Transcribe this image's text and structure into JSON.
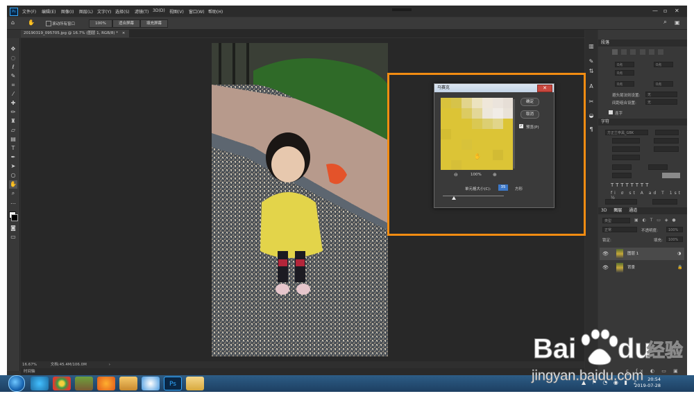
{
  "menubar": {
    "logo": "Ps",
    "items": [
      "文件(F)",
      "编辑(E)",
      "图像(I)",
      "图层(L)",
      "文字(Y)",
      "选择(S)",
      "滤镜(T)",
      "3D(D)",
      "视图(V)",
      "窗口(W)",
      "帮助(H)"
    ],
    "window_controls": [
      "—",
      "▫",
      "✕"
    ]
  },
  "options_bar": {
    "scroll_all_label": "滚动所有窗口",
    "zoom_button": "100%",
    "fit_button": "适合屏幕",
    "fill_button": "填充屏幕"
  },
  "document_tab": {
    "title": "20190319_095705.jpg @ 16.7% (图层 1, RGB/8) *",
    "close": "×"
  },
  "status_bar": {
    "zoom": "16.67%",
    "doc": "文档:45.4M/106.0M"
  },
  "timeline_label": "时间轴",
  "dialog": {
    "title": "马赛克",
    "ok_label": "确定",
    "cancel_label": "取消",
    "preview_label": "预览(P)",
    "preview_checked": true,
    "zoom_level": "100%",
    "cell_size_label": "单元格大小(C):",
    "cell_size_value": "35",
    "unit_label": "方形",
    "slider_fraction": 0.18
  },
  "panels": {
    "paragraph_title": "段落",
    "para_fields": [
      "0点",
      "0点",
      "0点",
      "0点",
      "0点"
    ],
    "hyphenation_label": "避头尾法则设置:",
    "hyphenation_value": "无",
    "spacing_label": "间距组合设置:",
    "spacing_value": "无",
    "hyphenate_label": "连字",
    "character_title": "字符",
    "font_value": "方正兰亭黑_GBK",
    "tabs": [
      "3D",
      "图层",
      "通道"
    ],
    "kind_placeholder": "类型",
    "blend_mode": "正常",
    "opacity_label": "不透明度:",
    "opacity_value": "100%",
    "lock_label": "锁定:",
    "fill_label": "填充:",
    "fill_value": "100%",
    "layers": [
      {
        "name": "图层 1"
      },
      {
        "name": "背景"
      }
    ]
  },
  "taskbar": {
    "time": "20:54",
    "date": "2019-07-28",
    "apps": [
      "ie",
      "chrome",
      "minecraft",
      "firefox",
      "notes",
      "baidu-netdisk",
      "photoshop",
      "explorer"
    ],
    "ps_label": "Ps"
  },
  "watermark": {
    "brand": "Bai",
    "brand2": "du",
    "suffix": "经验",
    "url": "jingyan.baidu.com"
  },
  "colors": {
    "highlight": "#f28c12",
    "ps_blue": "#31a8ff",
    "mosaic_yellow": "#dcc436"
  }
}
